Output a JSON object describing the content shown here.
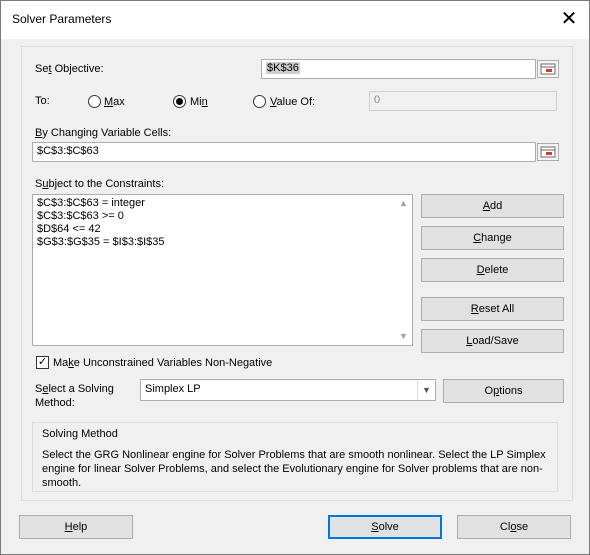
{
  "window": {
    "title": "Solver Parameters",
    "close_glyph": "✕"
  },
  "objective": {
    "label_pre": "Se",
    "label_ul": "t",
    "label_post": " Objective:",
    "value": "$K$36",
    "to_label": "To:",
    "max_label_ul": "M",
    "max_label_post": "ax",
    "min_label_pre": "Mi",
    "min_label_ul": "n",
    "valueof_label_ul": "V",
    "valueof_label_post": "alue Of:",
    "valueof_value": "0",
    "selected": "min"
  },
  "changing": {
    "label_ul": "B",
    "label_post": "y Changing Variable Cells:",
    "value": "$C$3:$C$63"
  },
  "constraints": {
    "label_pre": "S",
    "label_ul": "u",
    "label_post": "bject to the Constraints:",
    "items": [
      "$C$3:$C$63 = integer",
      "$C$3:$C$63 >= 0",
      "$D$64 <= 42",
      "$G$3:$G$35 = $I$3:$I$35"
    ]
  },
  "buttons": {
    "add_ul": "A",
    "add_post": "dd",
    "change_ul": "C",
    "change_post": "hange",
    "delete_ul": "D",
    "delete_post": "elete",
    "reset_ul": "R",
    "reset_post": "eset All",
    "load_ul": "L",
    "load_post": "oad/Save",
    "options_pre": "O",
    "options_ul": "p",
    "options_post": "tions",
    "help_ul": "H",
    "help_post": "elp",
    "solve_ul": "S",
    "solve_post": "olve",
    "close_pre": "Cl",
    "close_ul": "o",
    "close_post": "se"
  },
  "nonneg": {
    "checked": true,
    "label_pre": "Ma",
    "label_ul": "k",
    "label_post": "e Unconstrained Variables Non-Negative"
  },
  "method": {
    "label_pre": "S",
    "label_ul": "e",
    "label_post": "lect a Solving",
    "label_line2": "Method:",
    "selected": "Simplex LP"
  },
  "solving_method": {
    "title": "Solving Method",
    "description": "Select the GRG Nonlinear engine for Solver Problems that are smooth nonlinear. Select the LP Simplex engine for linear Solver Problems, and select the Evolutionary engine for Solver problems that are non-smooth."
  }
}
